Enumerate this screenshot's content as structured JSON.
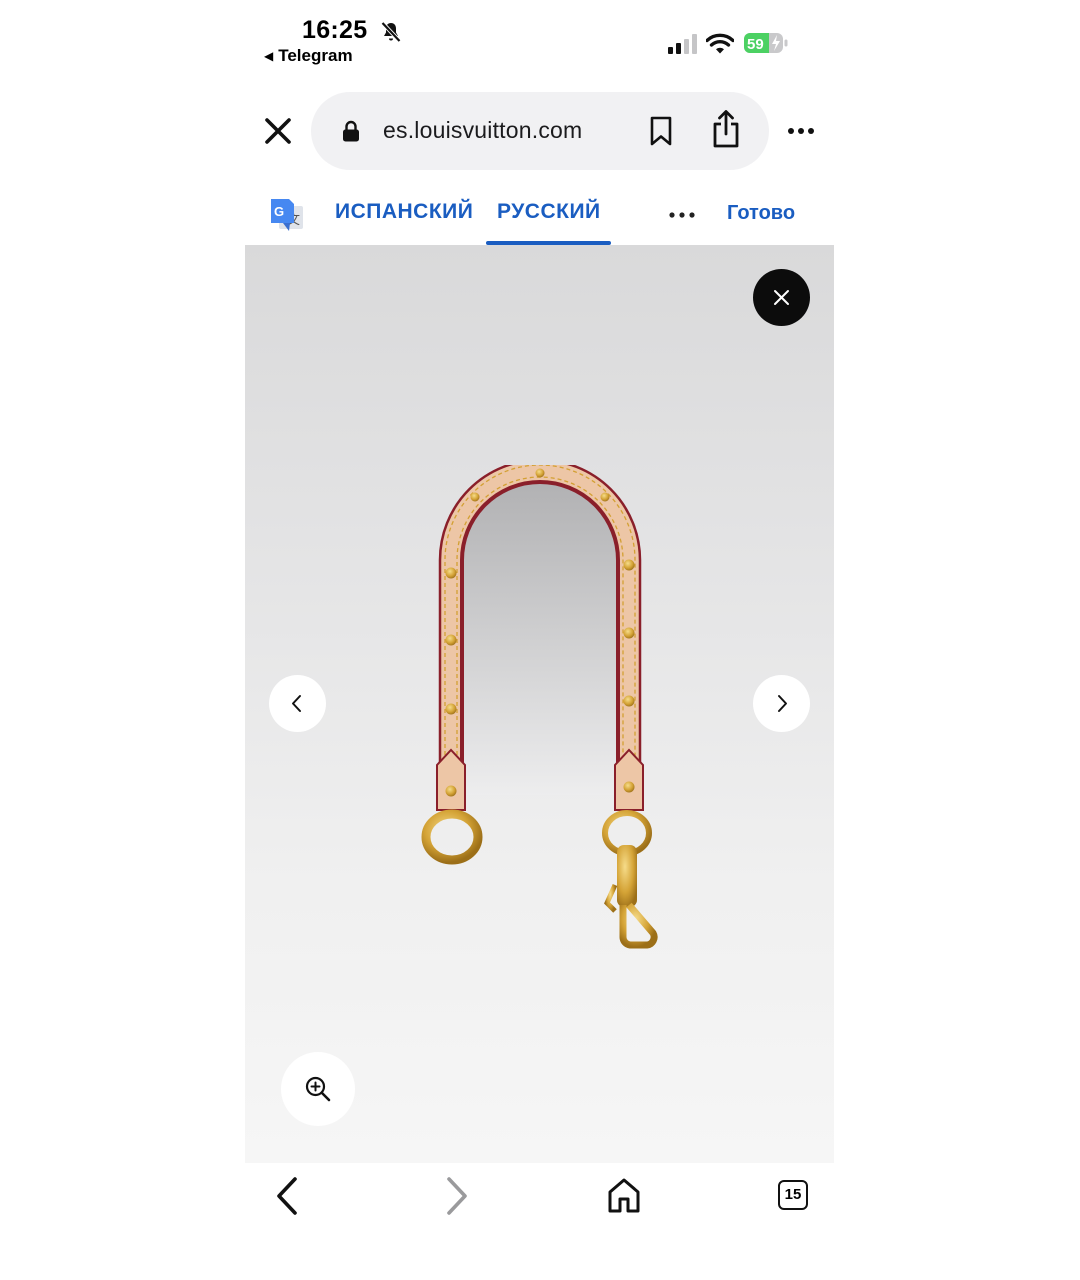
{
  "status_bar": {
    "time": "16:25",
    "back_app": "Telegram",
    "battery_percent": "59",
    "icons": [
      "bell-slash-icon",
      "cellular-signal-icon",
      "wifi-icon",
      "battery-charging-icon"
    ]
  },
  "address_bar": {
    "url": "es.louisvuitton.com",
    "icons": [
      "close-icon",
      "lock-icon",
      "bookmark-icon",
      "share-icon",
      "more-icon"
    ]
  },
  "translate_bar": {
    "source_language": "ИСПАНСКИЙ",
    "target_language": "РУССКИЙ",
    "active_tab": "target_language",
    "done_label": "Готово",
    "accent_color": "#1a5dc1"
  },
  "viewer": {
    "image_subject": "strap-image",
    "controls": [
      "close-icon",
      "chevron-left-icon",
      "chevron-right-icon",
      "zoom-in-icon"
    ]
  },
  "toolbar": {
    "tab_count": "15",
    "forward_enabled": false,
    "icons": [
      "back-icon",
      "forward-icon",
      "home-icon",
      "tabs-icon"
    ]
  }
}
